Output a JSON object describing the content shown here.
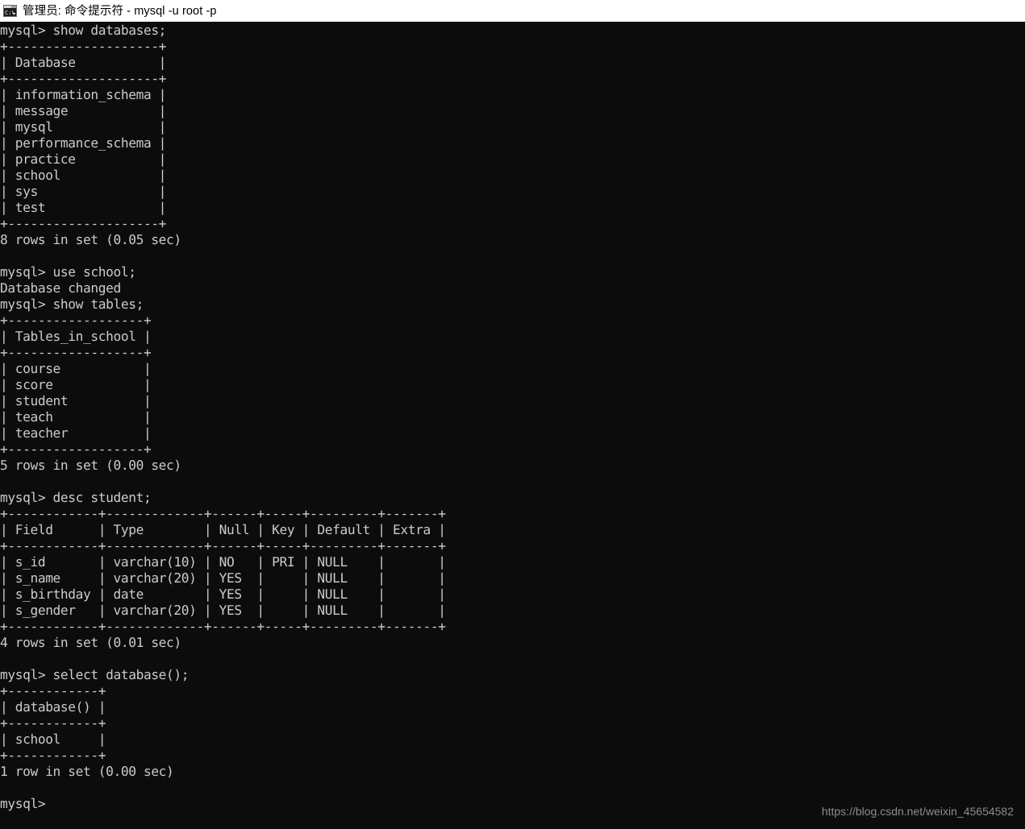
{
  "window": {
    "title": "管理员: 命令提示符 - mysql  -u root -p",
    "icon": "cmd-console-icon",
    "title_bar_bg": "#ffffff",
    "title_text_color": "#000000",
    "terminal_bg": "#0c0c0c",
    "terminal_fg": "#cccccc"
  },
  "watermark": {
    "text": "https://blog.csdn.net/weixin_45654582",
    "color": "#8d8d8d"
  },
  "session": {
    "prompt": "mysql>",
    "blocks": [
      {
        "command": "show databases;",
        "table": {
          "columns": [
            "Database"
          ],
          "widths": [
            20
          ],
          "rows": [
            [
              "information_schema"
            ],
            [
              "message"
            ],
            [
              "mysql"
            ],
            [
              "performance_schema"
            ],
            [
              "practice"
            ],
            [
              "school"
            ],
            [
              "sys"
            ],
            [
              "test"
            ]
          ]
        },
        "status": "8 rows in set (0.05 sec)"
      },
      {
        "command": "use school;",
        "message": "Database changed"
      },
      {
        "command": "show tables;",
        "table": {
          "columns": [
            "Tables_in_school"
          ],
          "widths": [
            18
          ],
          "rows": [
            [
              "course"
            ],
            [
              "score"
            ],
            [
              "student"
            ],
            [
              "teach"
            ],
            [
              "teacher"
            ]
          ]
        },
        "status": "5 rows in set (0.00 sec)"
      },
      {
        "command": "desc student;",
        "table": {
          "columns": [
            "Field",
            "Type",
            "Null",
            "Key",
            "Default",
            "Extra"
          ],
          "widths": [
            12,
            13,
            6,
            5,
            9,
            7
          ],
          "rows": [
            [
              "s_id",
              "varchar(10)",
              "NO",
              "PRI",
              "NULL",
              ""
            ],
            [
              "s_name",
              "varchar(20)",
              "YES",
              "",
              "NULL",
              ""
            ],
            [
              "s_birthday",
              "date",
              "YES",
              "",
              "NULL",
              ""
            ],
            [
              "s_gender",
              "varchar(20)",
              "YES",
              "",
              "NULL",
              ""
            ]
          ]
        },
        "status": "4 rows in set (0.01 sec)"
      },
      {
        "command": "select database();",
        "table": {
          "columns": [
            "database()"
          ],
          "widths": [
            12
          ],
          "rows": [
            [
              "school"
            ]
          ]
        },
        "status": "1 row in set (0.00 sec)"
      }
    ],
    "trailing_prompt": "mysql>"
  }
}
